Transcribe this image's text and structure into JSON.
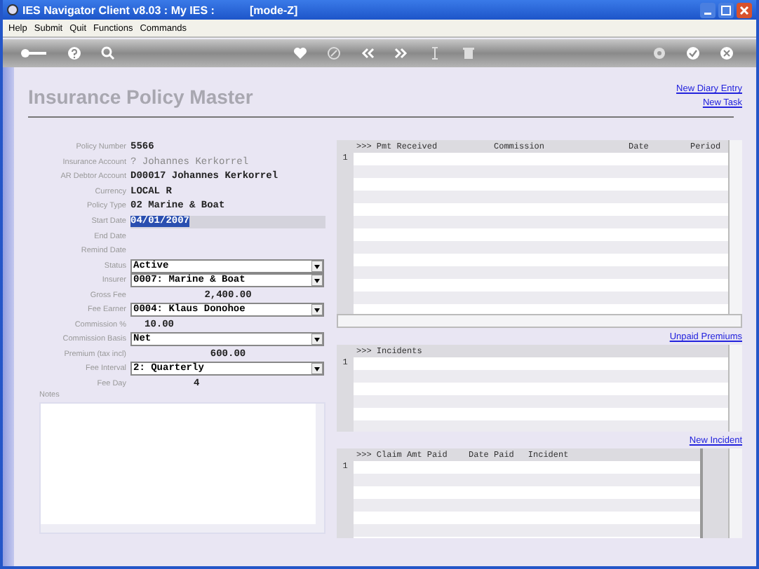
{
  "window": {
    "title": "IES Navigator Client v8.03 : My IES :",
    "mode": "[mode-Z]"
  },
  "menu": [
    "Help",
    "Submit",
    "Quit",
    "Functions",
    "Commands"
  ],
  "page": {
    "title": "Insurance Policy Master",
    "links": [
      "New Diary Entry",
      "New Task"
    ]
  },
  "form": {
    "fields": [
      {
        "label": "Policy Number",
        "kind": "text",
        "value": "5566"
      },
      {
        "label": "Insurance Account",
        "kind": "dim",
        "value": "? Johannes Kerkorrel"
      },
      {
        "label": "AR Debtor Account",
        "kind": "text",
        "value": "D00017 Johannes Kerkorrel"
      },
      {
        "label": "Currency",
        "kind": "text",
        "value": "LOCAL R"
      },
      {
        "label": "Policy Type",
        "kind": "text",
        "value": "02 Marine & Boat"
      },
      {
        "label": "Start Date",
        "kind": "date",
        "value": "04/01/2007",
        "selected": true
      },
      {
        "label": "End Date",
        "kind": "empty"
      },
      {
        "label": "Remind Date",
        "kind": "empty"
      },
      {
        "label": "Status",
        "kind": "dropdown",
        "value": "Active"
      },
      {
        "label": "Insurer",
        "kind": "dropdown",
        "value": "0007: Marine & Boat"
      },
      {
        "label": "Gross Fee",
        "kind": "amount",
        "value": "2,400.00"
      },
      {
        "label": "Fee Earner",
        "kind": "dropdown",
        "value": "0004: Klaus Donohoe"
      },
      {
        "label": "Commission %",
        "kind": "short",
        "value": "10.00"
      },
      {
        "label": "Commission Basis",
        "kind": "dropdown",
        "value": "Net"
      },
      {
        "label": "Premium (tax incl)",
        "kind": "amount",
        "value": "600.00"
      },
      {
        "label": "Fee Interval",
        "kind": "dropdown",
        "value": "2: Quarterly"
      },
      {
        "label": "Fee Day",
        "kind": "mid",
        "value": "4"
      }
    ],
    "notes_label": "Notes"
  },
  "grids": [
    {
      "kind": "wide",
      "columns": [
        ">>> Pmt Received",
        "Commission",
        "Date",
        "Period"
      ],
      "row_numbers": [
        "1"
      ],
      "link": "Unpaid Premiums"
    },
    {
      "kind": "short",
      "columns": [
        ">>> Incidents"
      ],
      "row_numbers": [
        "1"
      ],
      "link": "New Incident"
    },
    {
      "kind": "split",
      "columns": [
        ">>> Claim Amt Paid",
        "Date Paid",
        "Incident"
      ],
      "row_numbers": [
        "1"
      ]
    }
  ]
}
